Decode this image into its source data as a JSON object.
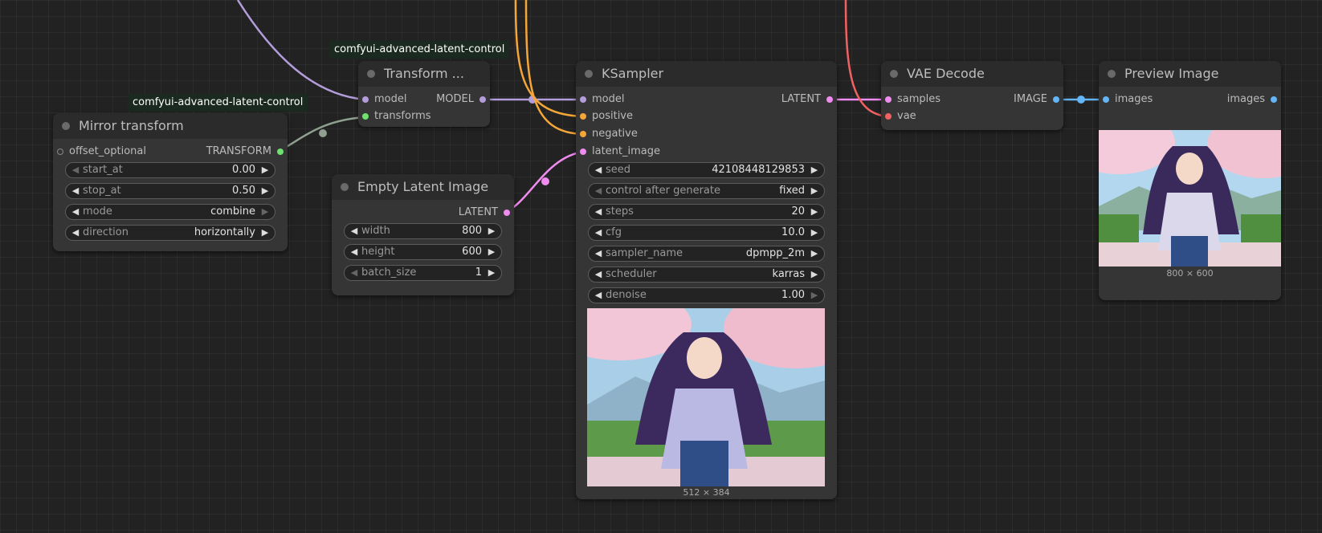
{
  "badges": {
    "mirror": "comfyui-advanced-latent-control",
    "transform": "comfyui-advanced-latent-control"
  },
  "colors": {
    "model": "#b39ddb",
    "transform": "#8fa08f",
    "latent": "#f08cf0",
    "conditioning": "#f5a638",
    "vae": "#f06262",
    "image": "#64b5f6"
  },
  "mirror": {
    "title": "Mirror transform",
    "input_offset": "offset_optional",
    "output": "TRANSFORM",
    "widgets": [
      {
        "label": "start_at",
        "value": "0.00"
      },
      {
        "label": "stop_at",
        "value": "0.50"
      },
      {
        "label": "mode",
        "value": "combine"
      },
      {
        "label": "direction",
        "value": "horizontally"
      }
    ]
  },
  "transform": {
    "title": "Transform ...",
    "input_model": "model",
    "input_transforms": "transforms",
    "output": "MODEL"
  },
  "empty_latent": {
    "title": "Empty Latent Image",
    "output": "LATENT",
    "widgets": [
      {
        "label": "width",
        "value": "800"
      },
      {
        "label": "height",
        "value": "600"
      },
      {
        "label": "batch_size",
        "value": "1"
      }
    ]
  },
  "ksampler": {
    "title": "KSampler",
    "inputs": [
      "model",
      "positive",
      "negative",
      "latent_image"
    ],
    "output": "LATENT",
    "widgets": [
      {
        "label": "seed",
        "value": "42108448129853"
      },
      {
        "label": "control after generate",
        "value": "fixed"
      },
      {
        "label": "steps",
        "value": "20"
      },
      {
        "label": "cfg",
        "value": "10.0"
      },
      {
        "label": "sampler_name",
        "value": "dpmpp_2m"
      },
      {
        "label": "scheduler",
        "value": "karras"
      },
      {
        "label": "denoise",
        "value": "1.00"
      }
    ],
    "preview_caption": "512 × 384"
  },
  "vae_decode": {
    "title": "VAE Decode",
    "input_samples": "samples",
    "input_vae": "vae",
    "output": "IMAGE"
  },
  "preview": {
    "title": "Preview Image",
    "input_images": "images",
    "output": "images",
    "caption": "800 × 600"
  }
}
